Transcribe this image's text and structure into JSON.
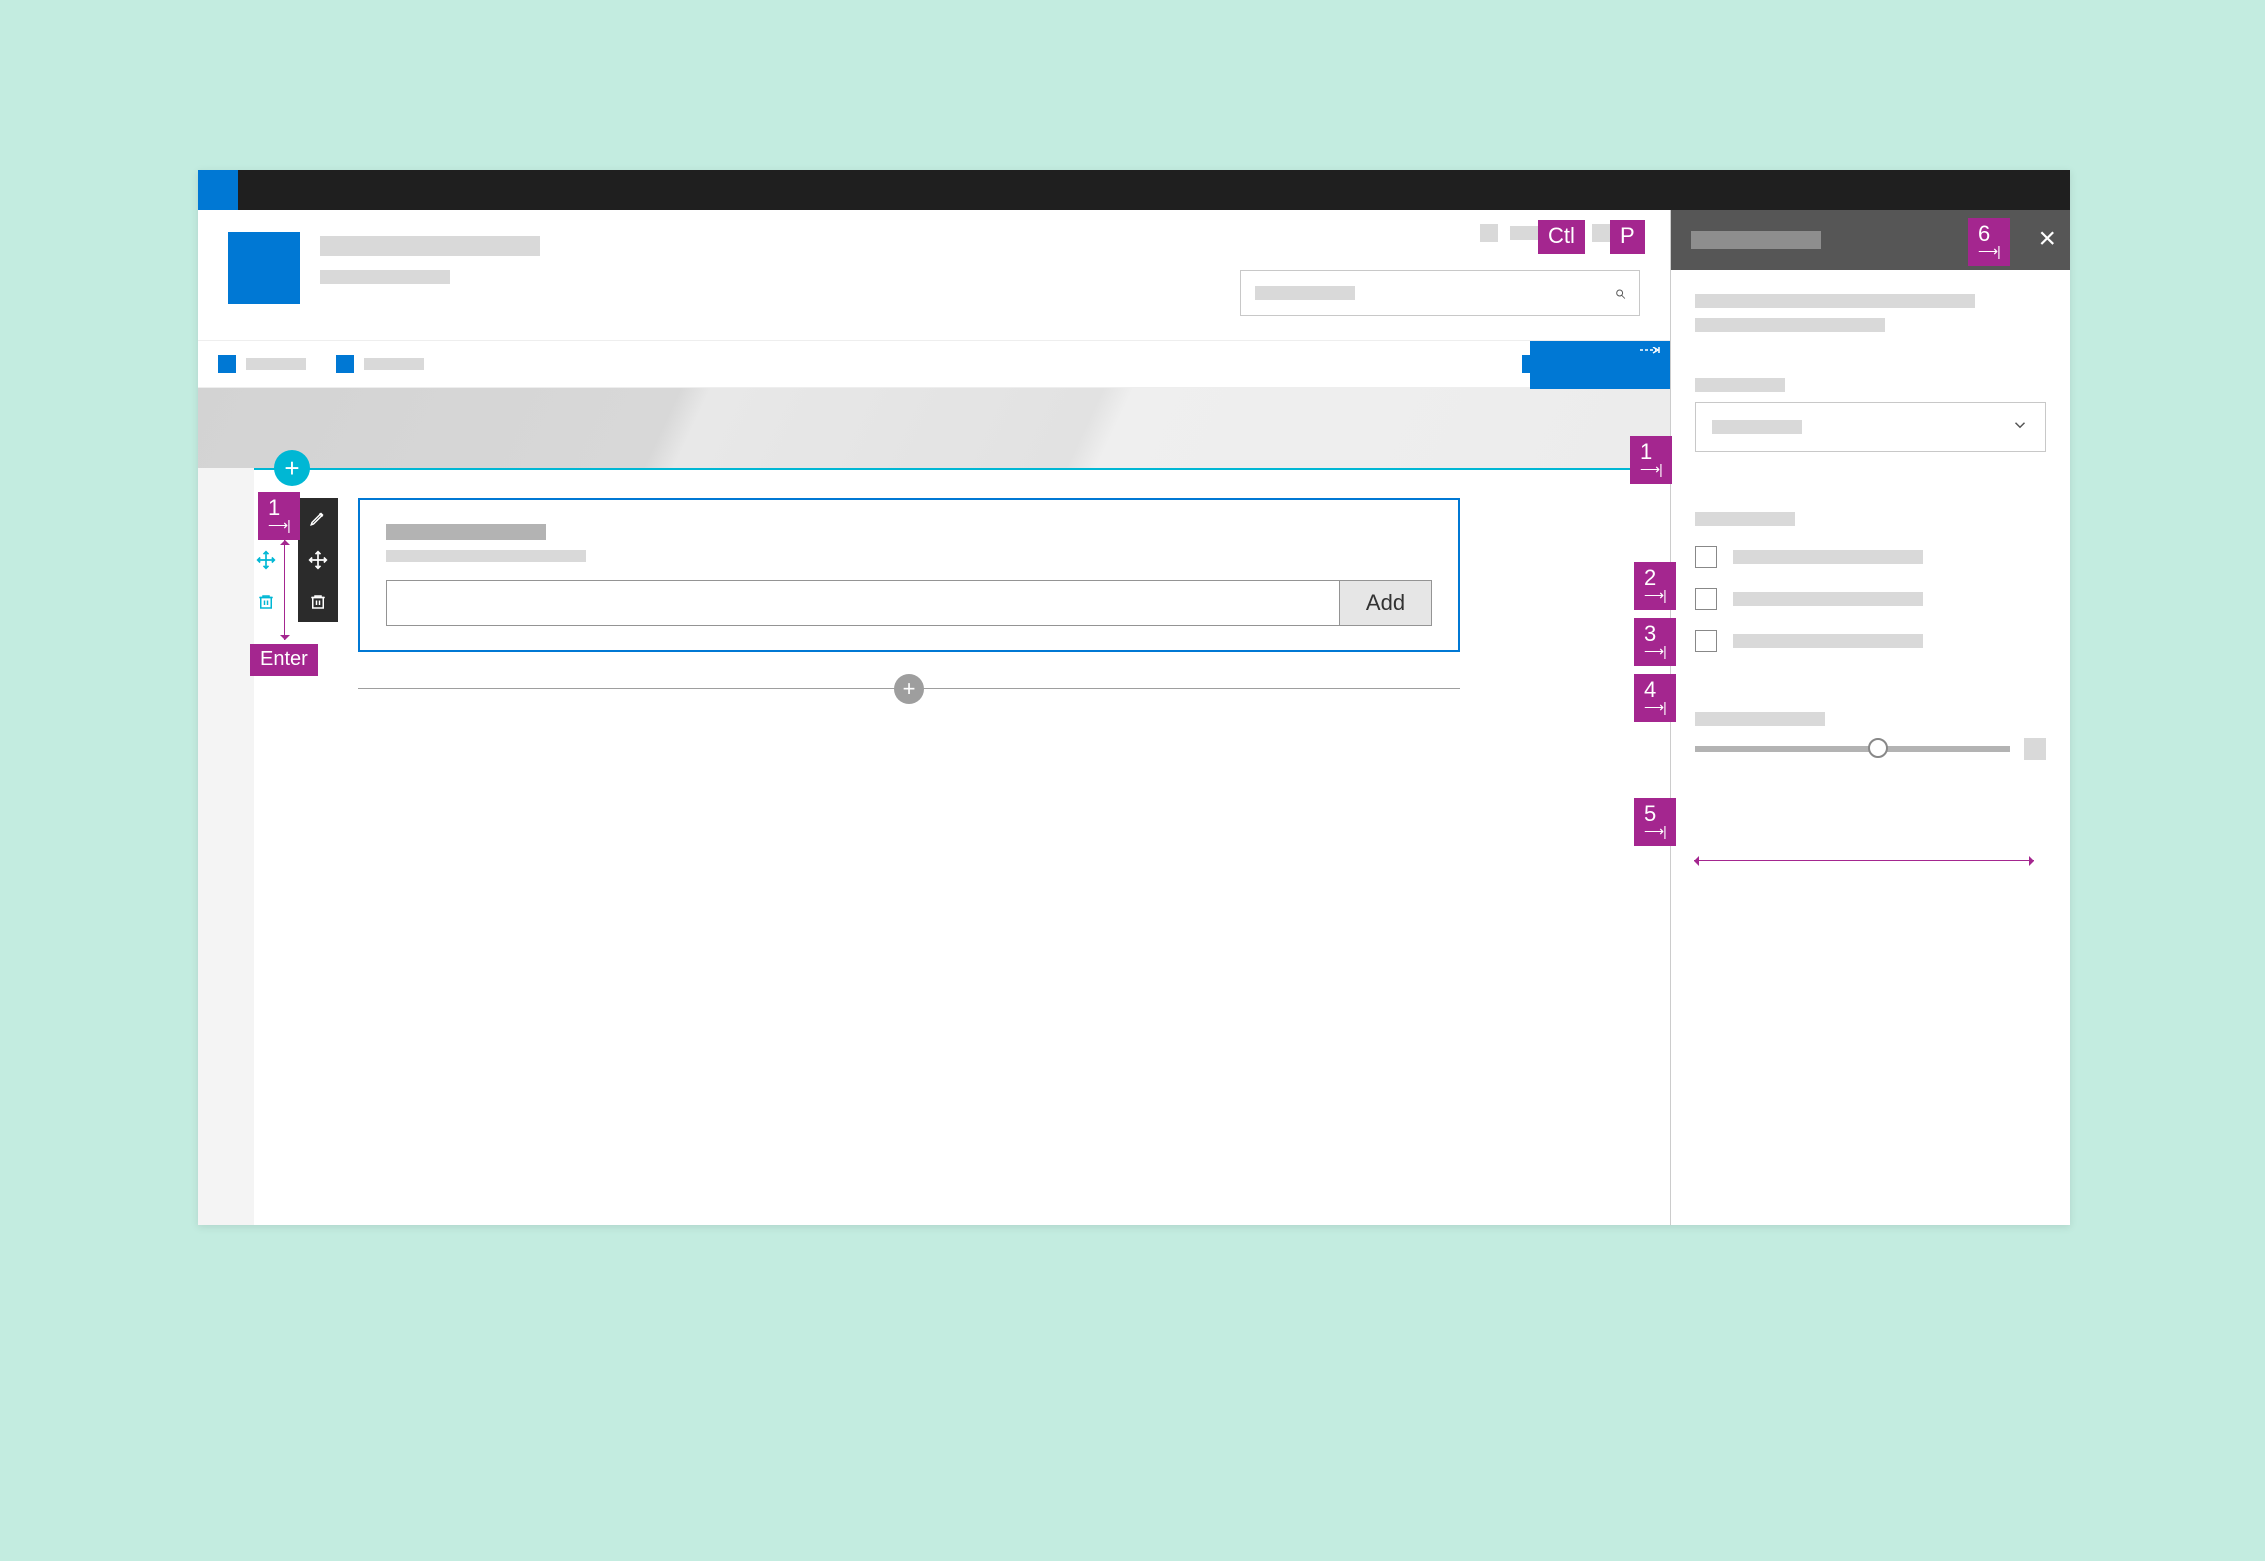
{
  "webpart": {
    "add_button": "Add"
  },
  "keys": {
    "ctl": "Ctl",
    "p": "P",
    "enter": "Enter"
  },
  "annotations": {
    "n1": "1",
    "n2": "2",
    "n3": "3",
    "n4": "4",
    "n5": "5",
    "n6": "6"
  }
}
